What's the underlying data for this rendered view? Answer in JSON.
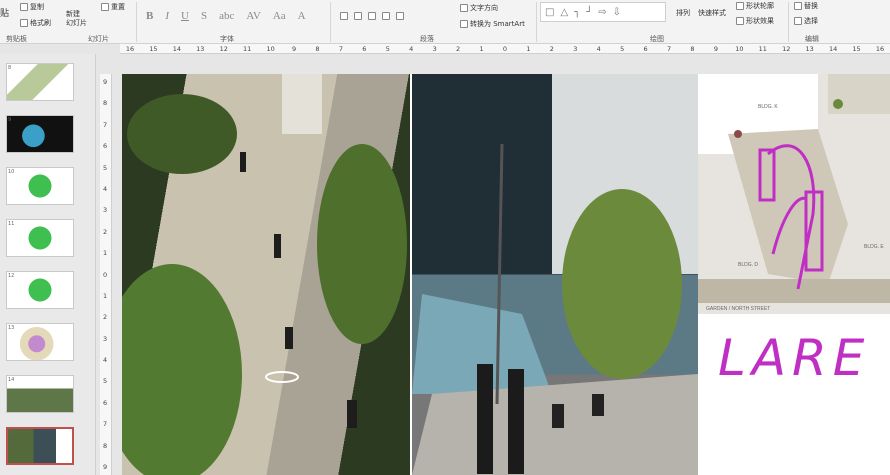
{
  "ribbon": {
    "paste": "贴",
    "copy": "复制",
    "format_painter": "格式刷",
    "new_slide": "新建\n幻灯片",
    "reset": "重置",
    "text_direction": "文字方向",
    "convert_smartart": "转换为 SmartArt",
    "arrange": "排列",
    "quick_styles": "快速样式",
    "shape_outline": "形状轮廓",
    "shape_effects": "形状效果",
    "replace": "替换",
    "select": "选择",
    "groups": [
      "剪贴板",
      "幻灯片",
      "字体",
      "段落",
      "绘图",
      "编辑"
    ]
  },
  "ruler": {
    "h_ticks": [
      "16",
      "15",
      "14",
      "13",
      "12",
      "11",
      "10",
      "9",
      "8",
      "7",
      "6",
      "5",
      "4",
      "3",
      "2",
      "1",
      "0",
      "1",
      "2",
      "3",
      "4",
      "5",
      "6",
      "7",
      "8",
      "9",
      "10",
      "11",
      "12",
      "13",
      "14",
      "15",
      "16"
    ],
    "v_ticks": [
      "9",
      "8",
      "7",
      "6",
      "5",
      "4",
      "3",
      "2",
      "1",
      "0",
      "1",
      "2",
      "3",
      "4",
      "5",
      "6",
      "7",
      "8",
      "9"
    ]
  },
  "thumbnails": [
    {
      "num": "8"
    },
    {
      "num": "9"
    },
    {
      "num": "10"
    },
    {
      "num": "11"
    },
    {
      "num": "12"
    },
    {
      "num": "13"
    },
    {
      "num": "14"
    },
    {
      "num": "15"
    }
  ],
  "slide": {
    "plan_labels": [
      "BLDG. K",
      "BLDG. D",
      "BLDG. E",
      "GARDEN / NORTH STREET"
    ],
    "handwriting": "LARE"
  },
  "colors": {
    "accent": "#c02fc4",
    "active_thumb": "#c0504d"
  }
}
